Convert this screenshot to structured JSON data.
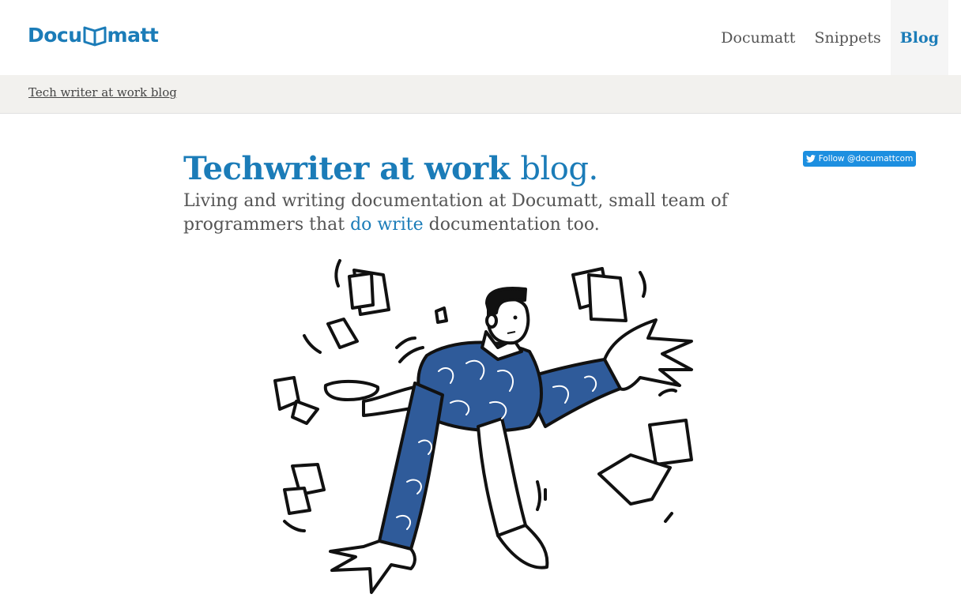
{
  "header": {
    "logo_left": "Docu",
    "logo_right": "matt",
    "nav": [
      {
        "label": "Documatt"
      },
      {
        "label": "Snippets"
      },
      {
        "label": "Blog",
        "active": true
      }
    ]
  },
  "breadcrumb": "Tech writer at work blog",
  "hero": {
    "title_bold": "Techwriter at work",
    "title_light": "blog.",
    "lead_before": "Living and writing documentation at Documatt, small team of programmers that",
    "lead_link": "do write",
    "lead_after": "documentation too."
  },
  "follow_button": "Follow @documattcom",
  "colors": {
    "brand": "#1b7cb8",
    "twitter": "#1d8fe0",
    "shirt": "#2f5b9a",
    "subbar": "#f2f1ee"
  }
}
